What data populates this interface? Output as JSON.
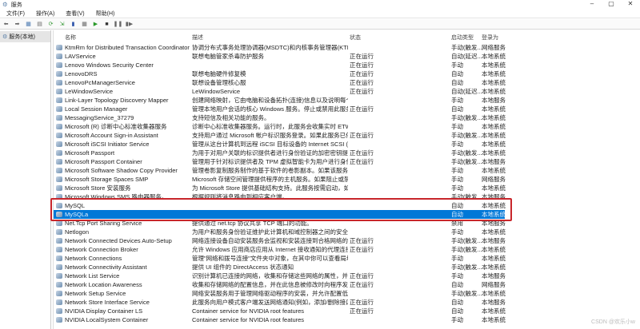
{
  "window": {
    "title": "服务",
    "controls": [
      "minimize",
      "maximize",
      "close"
    ]
  },
  "menu": [
    "文件(F)",
    "操作(A)",
    "查看(V)",
    "帮助(H)"
  ],
  "toolbar": [
    "back",
    "forward",
    "show-tree",
    "properties",
    "refresh",
    "export",
    "help",
    "show-pane",
    "start",
    "stop",
    "pause",
    "restart"
  ],
  "tree": {
    "root": "服务(本地)"
  },
  "columns": {
    "name": "名称",
    "desc": "描述",
    "status": "状态",
    "start": "启动类型",
    "logon": "登录为"
  },
  "rows": [
    {
      "name": "KtmRm for Distributed Transaction Coordinator",
      "desc": "协调分布式事务处理协调器(MSDTC)和内核事务管理器(KTM)之间...",
      "status": "",
      "start": "手动(触发...",
      "logon": "网络服务"
    },
    {
      "name": "LAVService",
      "desc": "联想电脑管家杀毒防护服务",
      "status": "正在运行",
      "start": "自动(延迟...",
      "logon": "本地系统"
    },
    {
      "name": "Lenovo Windows Security Center",
      "desc": "",
      "status": "正在运行",
      "start": "手动",
      "logon": "本地系统"
    },
    {
      "name": "LenovoDRS",
      "desc": "联想电脑硬件修复模",
      "status": "正在运行",
      "start": "自动",
      "logon": "本地系统"
    },
    {
      "name": "LenovoPcManagerService",
      "desc": "联想设备管理核心服",
      "status": "正在运行",
      "start": "自动",
      "logon": "本地系统"
    },
    {
      "name": "LeWindowService",
      "desc": "LeWindowService",
      "status": "正在运行",
      "start": "自动(延迟...",
      "logon": "本地系统"
    },
    {
      "name": "Link-Layer Topology Discovery Mapper",
      "desc": "创建网络映射，它由电脑和设备拓扑(连接)信息以及说明每个电脑...",
      "status": "",
      "start": "手动",
      "logon": "本地服务"
    },
    {
      "name": "Local Session Manager",
      "desc": "管理本地用户会话的核心 Windows 服务。停止或禁用此服务将导...",
      "status": "正在运行",
      "start": "自动",
      "logon": "本地系统"
    },
    {
      "name": "MessagingService_37279",
      "desc": "支持短信及相关功能的服务。",
      "status": "",
      "start": "手动(触发...",
      "logon": "本地系统"
    },
    {
      "name": "Microsoft (R) 诊断中心标准收集器服务",
      "desc": "诊断中心标准收集器服务。运行时，此服务会收集实时 ETW 事件...",
      "status": "",
      "start": "手动",
      "logon": "本地系统"
    },
    {
      "name": "Microsoft Account Sign-in Assistant",
      "desc": "支持用户通过 Microsoft 帐户标识服务登录。如果此服务已停止，...",
      "status": "正在运行",
      "start": "手动(触发...",
      "logon": "本地系统"
    },
    {
      "name": "Microsoft iSCSI Initiator Service",
      "desc": "管理从这台计算机到远程 iSCSI 目标设备的 Internet SCSI (iSCSI)会...",
      "status": "",
      "start": "手动",
      "logon": "本地系统"
    },
    {
      "name": "Microsoft Passport",
      "desc": "为用于对用户关联的标识提供者进行身份验证的加密密钥提供进程...",
      "status": "正在运行",
      "start": "手动(触发...",
      "logon": "本地系统"
    },
    {
      "name": "Microsoft Passport Container",
      "desc": "管理用于针对标识提供者及 TPM 虚拟智能卡为用户进行身份验证...",
      "status": "正在运行",
      "start": "手动(触发...",
      "logon": "本地服务"
    },
    {
      "name": "Microsoft Software Shadow Copy Provider",
      "desc": "管理卷影复制服务制作的基于软件的卷影副本。如果该服务被停止...",
      "status": "",
      "start": "手动",
      "logon": "本地系统"
    },
    {
      "name": "Microsoft Storage Spaces SMP",
      "desc": "Microsoft 存储空间管理提供程序的主机服务。如果阻止或禁用这...",
      "status": "",
      "start": "手动",
      "logon": "网络服务"
    },
    {
      "name": "Microsoft Store 安装服务",
      "desc": "为 Microsoft Store 提供基础结构支持。此服务按需启动，如被禁...",
      "status": "",
      "start": "手动",
      "logon": "本地系统"
    },
    {
      "name": "Microsoft Windows SMS 路由器服务。",
      "desc": "根据规则将消息路由到相应客户端。",
      "status": "",
      "start": "手动(触发...",
      "logon": "本地服务"
    },
    {
      "name": "MySQL",
      "desc": "",
      "status": "",
      "start": "自动",
      "logon": "本地系统"
    },
    {
      "name": "MySQLa",
      "desc": "",
      "status": "",
      "start": "自动",
      "logon": "本地系统",
      "selected": true
    },
    {
      "name": "Net.Tcp Port Sharing Service",
      "desc": "提供通过 net.tcp 协议共享 TCP 端口的功能。",
      "status": "",
      "start": "禁用",
      "logon": "本地服务"
    },
    {
      "name": "Netlogon",
      "desc": "为用户和服务身份验证维护此计算机和域控制器之间的安全通道。...",
      "status": "",
      "start": "手动",
      "logon": "本地系统"
    },
    {
      "name": "Network Connected Devices Auto-Setup",
      "desc": "网络连接设备自动安装服务会监视和安装连接到合格网络的合格设...",
      "status": "正在运行",
      "start": "手动(触发...",
      "logon": "本地服务"
    },
    {
      "name": "Network Connection Broker",
      "desc": "允许 Windows 应用商店应用从 Internet 接收通知的代理连接。",
      "status": "正在运行",
      "start": "手动(触发...",
      "logon": "本地系统"
    },
    {
      "name": "Network Connections",
      "desc": "管理\"网络和拨号连接\"文件夹中对象，在其中你可以查看局域网和...",
      "status": "",
      "start": "手动",
      "logon": "本地系统"
    },
    {
      "name": "Network Connectivity Assistant",
      "desc": "提供 UI 组件的 DirectAccess 状态通知",
      "status": "",
      "start": "手动(触发...",
      "logon": "本地系统"
    },
    {
      "name": "Network List Service",
      "desc": "识别计算机已连接的网络，收集和存储这些网络的属性，并在更改...",
      "status": "正在运行",
      "start": "手动",
      "logon": "本地服务"
    },
    {
      "name": "Network Location Awareness",
      "desc": "收集和存储网络的配置信息，并在此信息被修改时向程序发出通知...",
      "status": "正在运行",
      "start": "自动",
      "logon": "网络服务"
    },
    {
      "name": "Network Setup Service",
      "desc": "网络安装服务用于管理网络驱动程序的安装，并允许配置低级别网...",
      "status": "",
      "start": "手动(触发...",
      "logon": "本地系统"
    },
    {
      "name": "Network Store Interface Service",
      "desc": "此服务向用户模式客户端发送网络通知(例如，添加/删除接口等)。...",
      "status": "正在运行",
      "start": "自动",
      "logon": "本地服务"
    },
    {
      "name": "NVIDIA Display Container LS",
      "desc": "Container service for NVIDIA root features",
      "status": "正在运行",
      "start": "自动",
      "logon": "本地系统"
    },
    {
      "name": "NVIDIA LocalSystem Container",
      "desc": "Container service for NVIDIA root features",
      "status": "",
      "start": "手动",
      "logon": "本地系统"
    }
  ],
  "watermark": "CSDN @欢乐小w",
  "colors": {
    "selection": "#0078d7",
    "highlight_box": "#c8262b"
  }
}
